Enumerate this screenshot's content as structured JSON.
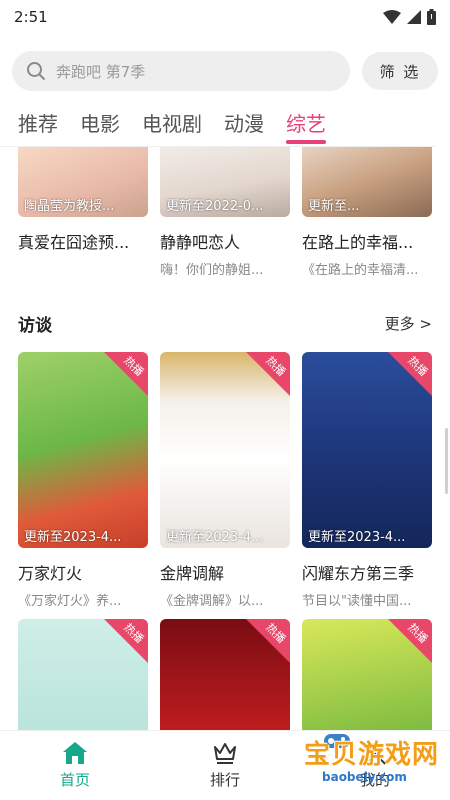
{
  "status_bar": {
    "time": "2:51"
  },
  "search": {
    "placeholder": "奔跑吧 第7季",
    "filter_label": "筛 选"
  },
  "tabs": [
    {
      "label": "推荐",
      "active": false
    },
    {
      "label": "电影",
      "active": false
    },
    {
      "label": "电视剧",
      "active": false
    },
    {
      "label": "动漫",
      "active": false
    },
    {
      "label": "综艺",
      "active": true
    }
  ],
  "top_row": [
    {
      "overlay": "陶晶莹为教授...",
      "title": "真爱在囧途预...",
      "subtitle": ""
    },
    {
      "overlay": "更新至2022-0...",
      "title": "静静吧恋人",
      "subtitle": "嗨！你们的静姐..."
    },
    {
      "overlay": "更新至...",
      "title": "在路上的幸福...",
      "subtitle": "《在路上的幸福清..."
    }
  ],
  "section": {
    "title": "访谈",
    "more": "更多 >"
  },
  "interview_row": [
    {
      "badge": "热播",
      "overlay": "更新至2023-4...",
      "title": "万家灯火",
      "subtitle": "《万家灯火》养..."
    },
    {
      "badge": "热播",
      "overlay": "更新至2023-4...",
      "title": "金牌调解",
      "subtitle": "《金牌调解》以..."
    },
    {
      "badge": "热播",
      "overlay": "更新至2023-4...",
      "title": "闪耀东方第三季",
      "subtitle": "节目以\"读懂中国..."
    }
  ],
  "bottom_row": [
    {
      "badge": "热播"
    },
    {
      "badge": "热播"
    },
    {
      "badge": "热播"
    }
  ],
  "bottom_nav": [
    {
      "label": "首页",
      "icon": "home-icon",
      "active": true
    },
    {
      "label": "排行",
      "icon": "crown-icon",
      "active": false
    },
    {
      "label": "我的",
      "icon": "user-icon",
      "active": false
    }
  ],
  "watermark": {
    "title": "宝贝游戏网",
    "url": "baobeiy.com"
  },
  "colors": {
    "accent": "#e8407a",
    "nav_active": "#17a78a",
    "hot_badge": "#e8476a"
  }
}
